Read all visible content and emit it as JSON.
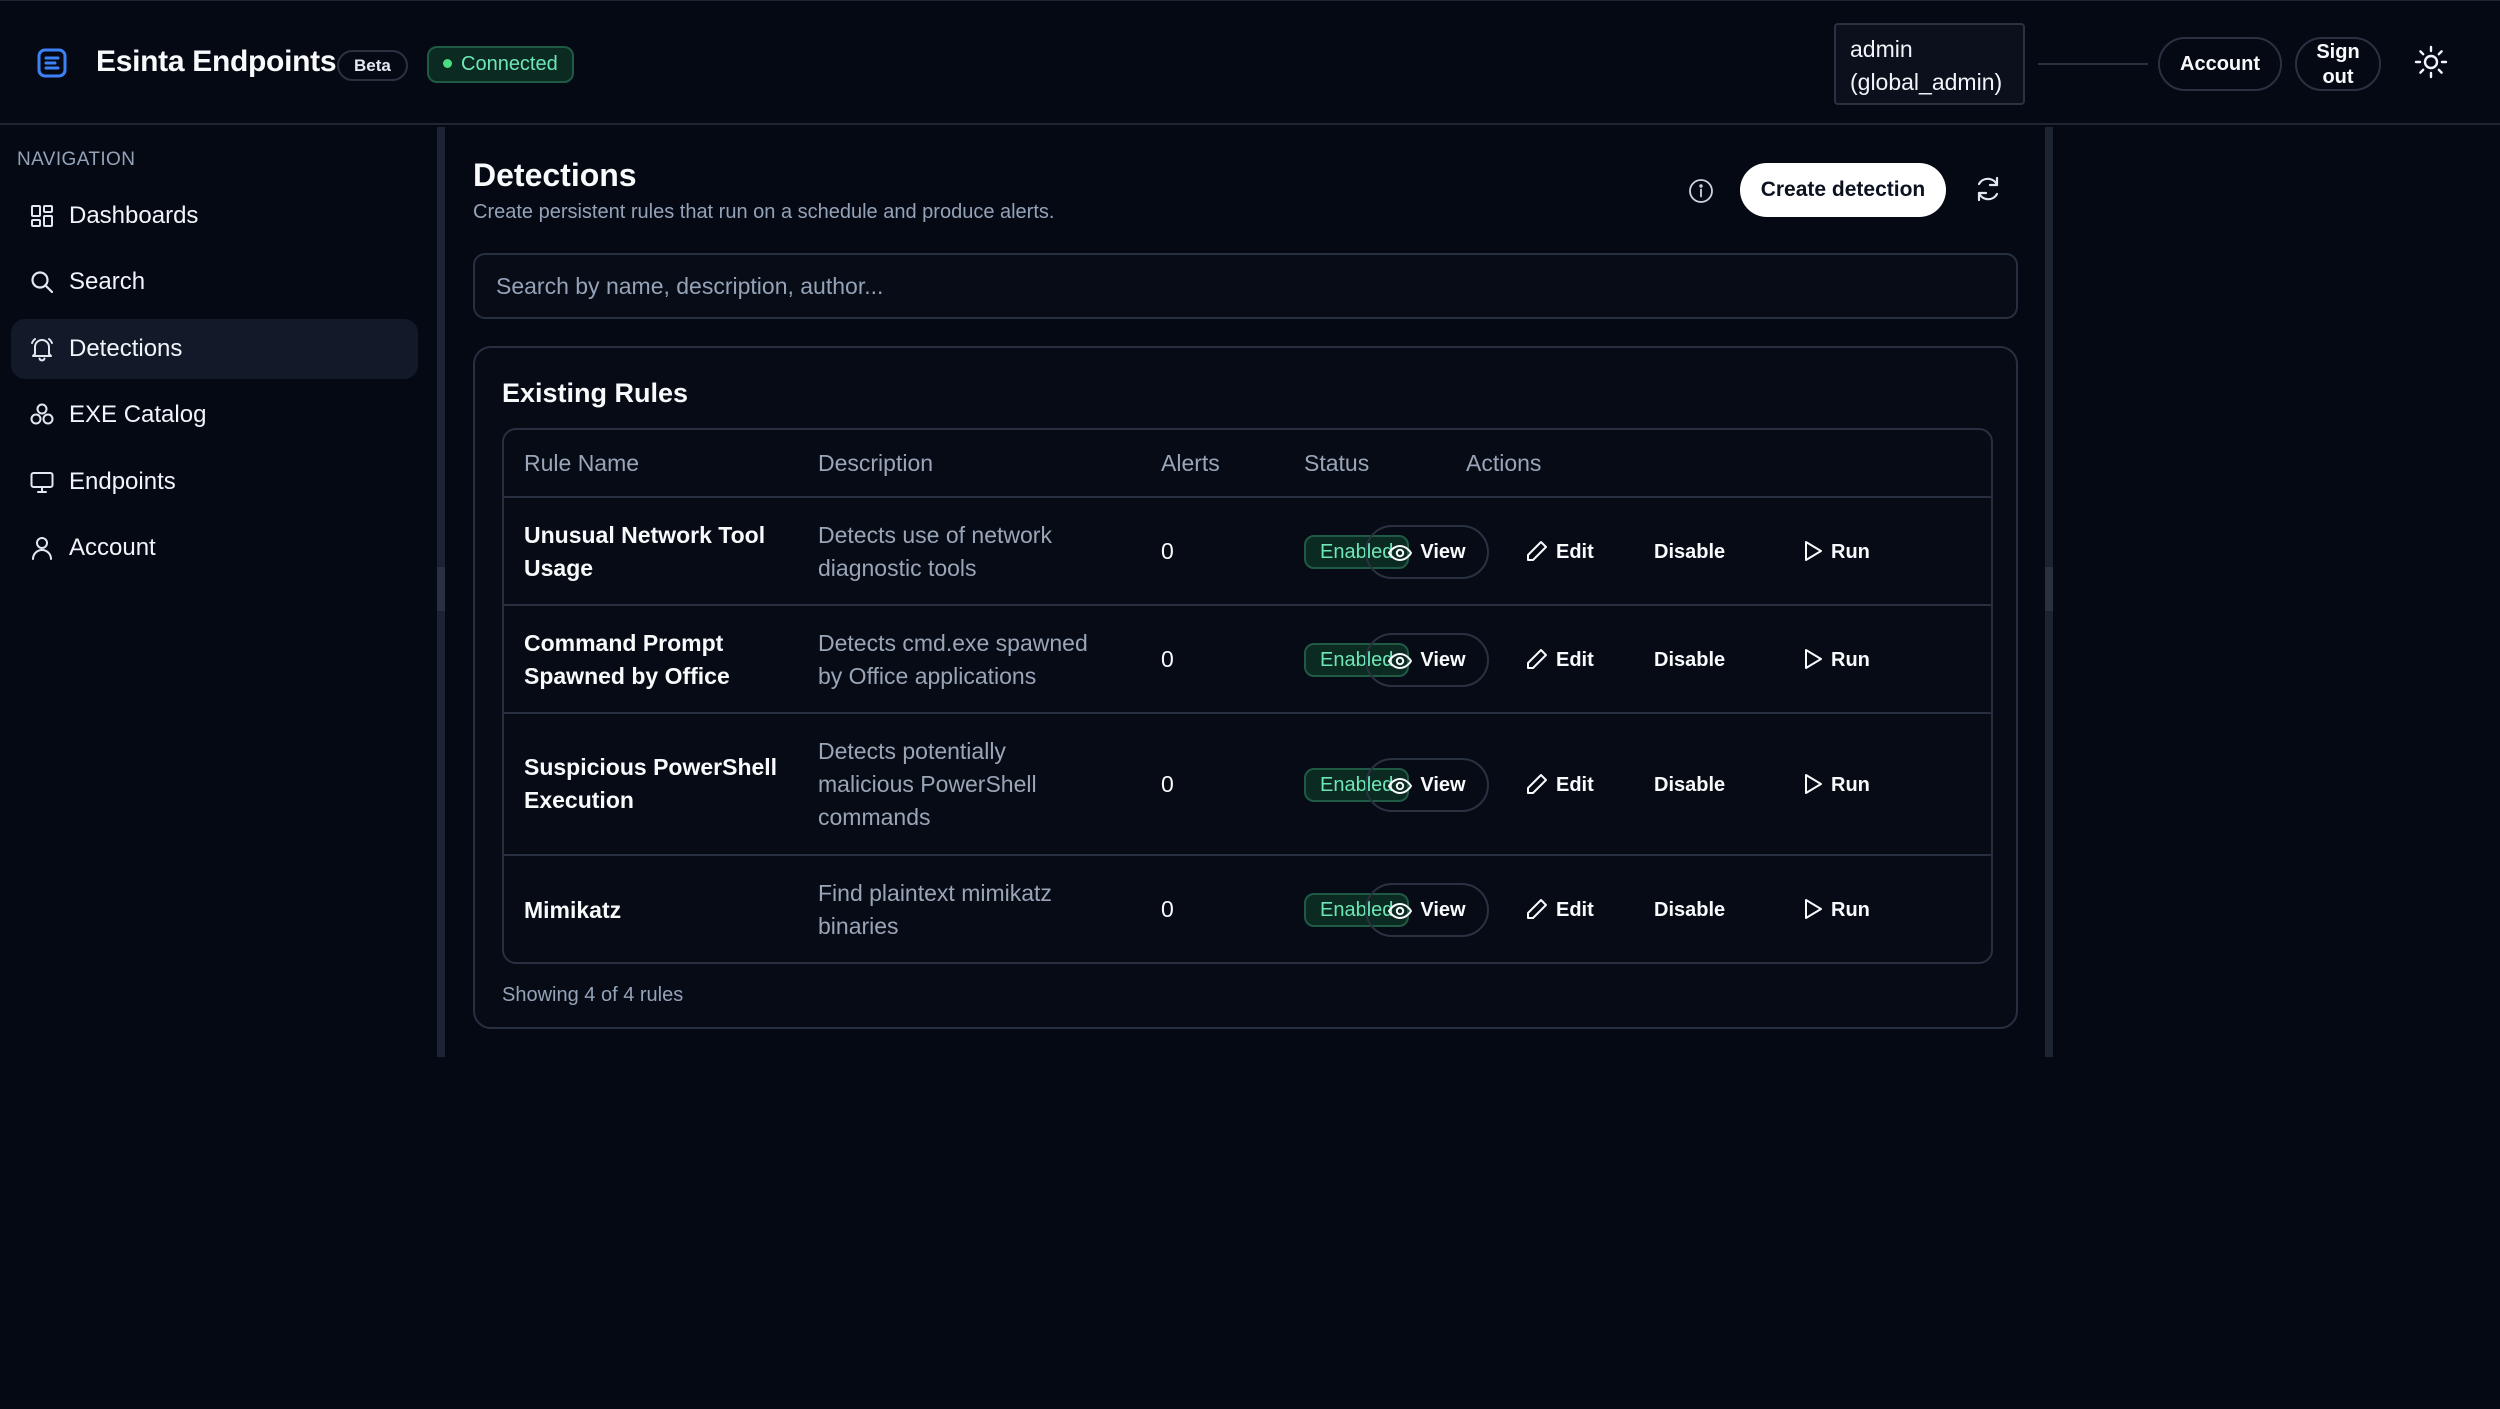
{
  "header": {
    "app_title": "Esinta Endpoints",
    "beta_badge": "Beta",
    "connection_status": "Connected",
    "user_label_line1": "admin",
    "user_label_line2": "(global_admin)",
    "account_label": "Account",
    "signout_line1": "Sign",
    "signout_line2": "out",
    "logo_icon": "esinta-logo-icon",
    "theme_icon": "sun-icon"
  },
  "sidebar": {
    "heading": "NAVIGATION",
    "items": [
      {
        "label": "Dashboards",
        "icon": "dashboard-icon",
        "active": false
      },
      {
        "label": "Search",
        "icon": "search-icon",
        "active": false
      },
      {
        "label": "Detections",
        "icon": "bell-icon",
        "active": true
      },
      {
        "label": "EXE Catalog",
        "icon": "catalog-icon",
        "active": false
      },
      {
        "label": "Endpoints",
        "icon": "monitor-icon",
        "active": false
      },
      {
        "label": "Account",
        "icon": "user-icon",
        "active": false
      }
    ]
  },
  "main": {
    "title": "Detections",
    "subtitle": "Create persistent rules that run on a schedule and produce alerts.",
    "create_button": "Create detection",
    "search_placeholder": "Search by name, description, author...",
    "card_title": "Existing Rules",
    "columns": [
      "Rule Name",
      "Description",
      "Alerts",
      "Status",
      "Actions"
    ],
    "rows": [
      {
        "name_l1": "Unusual Network Tool",
        "name_l2": "Usage",
        "desc_l1": "Detects use of network",
        "desc_l2": "diagnostic tools",
        "desc_l3": "",
        "alerts": "0",
        "status": "Enabled"
      },
      {
        "name_l1": "Command Prompt",
        "name_l2": "Spawned by Office",
        "desc_l1": "Detects cmd.exe spawned",
        "desc_l2": "by Office applications",
        "desc_l3": "",
        "alerts": "0",
        "status": "Enabled"
      },
      {
        "name_l1": "Suspicious PowerShell",
        "name_l2": "Execution",
        "desc_l1": "Detects potentially",
        "desc_l2": "malicious PowerShell",
        "desc_l3": "commands",
        "alerts": "0",
        "status": "Enabled"
      },
      {
        "name_l1": "Mimikatz",
        "name_l2": "",
        "desc_l1": "Find plaintext mimikatz",
        "desc_l2": "binaries",
        "desc_l3": "",
        "alerts": "0",
        "status": "Enabled"
      }
    ],
    "actions": {
      "view": "View",
      "edit": "Edit",
      "disable": "Disable",
      "run": "Run"
    },
    "footer": "Showing 4 of 4 rules"
  },
  "colors": {
    "background": "#050914",
    "accent_green": "#6ee7b7",
    "brand_blue": "#3b82f6"
  }
}
